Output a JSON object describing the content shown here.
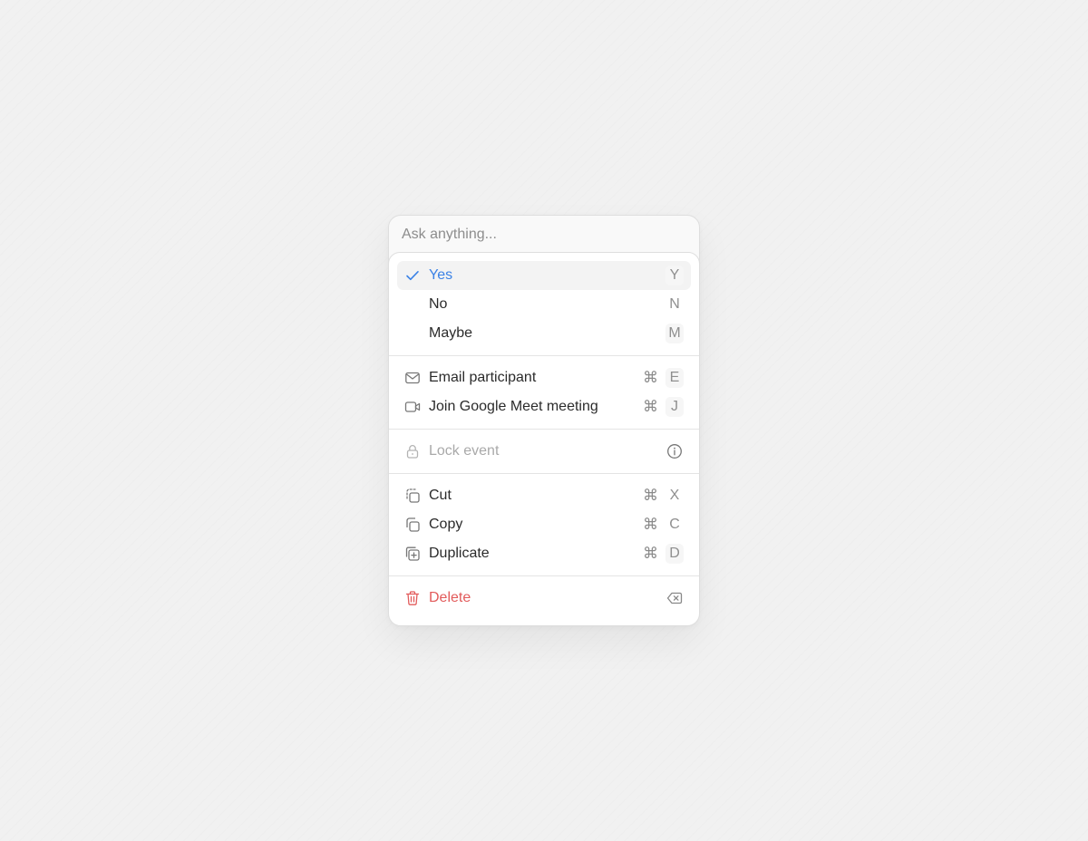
{
  "search": {
    "placeholder": "Ask anything..."
  },
  "colors": {
    "accent": "#3b82e6",
    "danger": "#e25b5b",
    "disabled": "#a9a9a9",
    "shortcut": "#8f8f8f"
  },
  "rsvp": [
    {
      "label": "Yes",
      "shortcut": "Y",
      "icon": "check-icon",
      "selected": true
    },
    {
      "label": "No",
      "shortcut": "N"
    },
    {
      "label": "Maybe",
      "shortcut": "M"
    }
  ],
  "actions": [
    {
      "label": "Email participant",
      "modifier": "⌘",
      "shortcut": "E",
      "icon": "mail-icon"
    },
    {
      "label": "Join Google Meet meeting",
      "modifier": "⌘",
      "shortcut": "J",
      "icon": "video-icon"
    }
  ],
  "lock": {
    "label": "Lock event",
    "icon": "lock-icon",
    "trailing_icon": "info-icon",
    "disabled": true
  },
  "clipboard": [
    {
      "label": "Cut",
      "modifier": "⌘",
      "shortcut": "X",
      "icon": "cut-icon"
    },
    {
      "label": "Copy",
      "modifier": "⌘",
      "shortcut": "C",
      "icon": "copy-icon"
    },
    {
      "label": "Duplicate",
      "modifier": "⌘",
      "shortcut": "D",
      "icon": "duplicate-icon"
    }
  ],
  "delete": {
    "label": "Delete",
    "icon": "trash-icon",
    "trailing_icon": "backspace-icon"
  }
}
